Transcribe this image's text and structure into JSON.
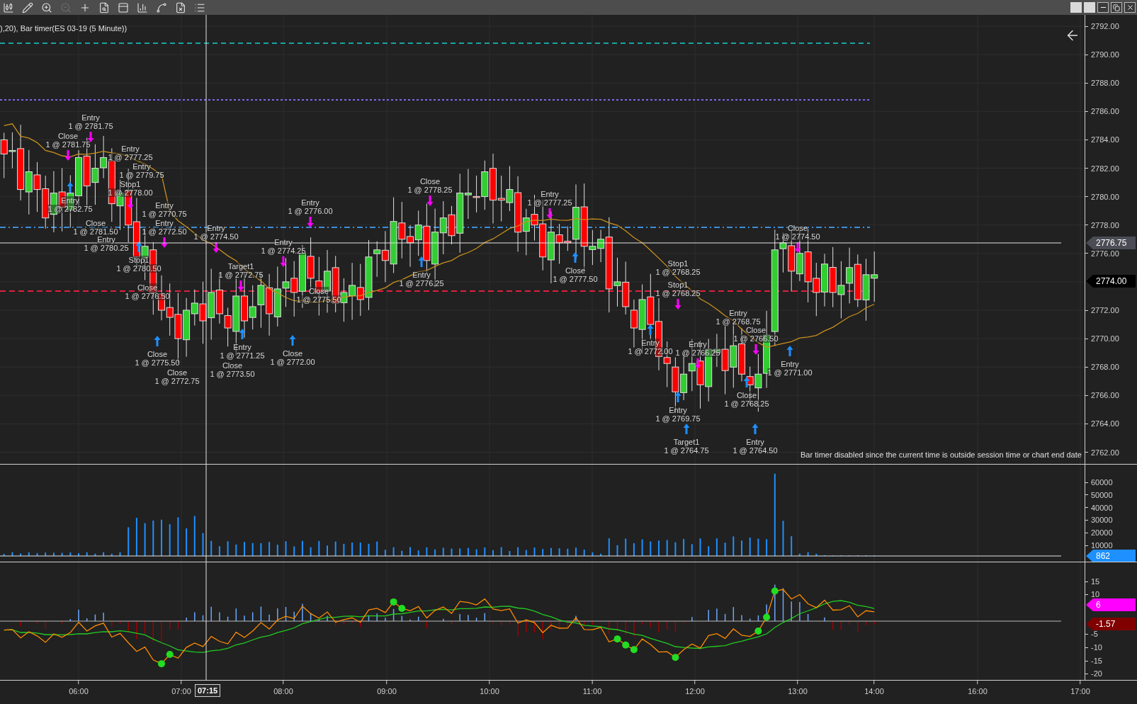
{
  "toolbar": [
    {
      "disabled": false
    },
    {
      "disabled": false
    },
    {
      "disabled": false
    },
    {
      "disabled": true
    },
    {
      "disabled": false
    },
    {
      "disabled": false
    },
    {
      "disabled": false
    },
    {
      "disabled": false
    },
    {
      "disabled": false
    },
    {
      "disabled": false
    },
    {
      "disabled": false
    }
  ],
  "chart_title": "),20), Bar timer(ES 03-19 (5 Minute))",
  "price_axis": {
    "ticks": [
      "2792.00",
      "2790.00",
      "2788.00",
      "2786.00",
      "2784.00",
      "2782.00",
      "2780.00",
      "2778.00",
      "2776.00",
      "2772.00",
      "2770.00",
      "2768.00",
      "2766.00",
      "2764.00",
      "2762.00"
    ],
    "markers": [
      {
        "kind": "crosshair",
        "text": "2776.75"
      },
      {
        "kind": "last",
        "text": "2774.00"
      }
    ]
  },
  "trade_labels": [
    {
      "name": "Entry",
      "price": "1 @ 2781.75"
    },
    {
      "name": "Close",
      "price": "1 @ 2781.75"
    },
    {
      "name": "Entry",
      "price": "1 @ 2777.25"
    },
    {
      "name": "Entry",
      "price": "1 @ 2779.75"
    },
    {
      "name": "Entry",
      "price": "1 @ 2782.75"
    },
    {
      "name": "Stop1",
      "price": "1 @ 2778.00"
    },
    {
      "name": "Entry",
      "price": "1 @ 2770.75"
    },
    {
      "name": "Entry",
      "price": "1 @ 2776.00"
    },
    {
      "name": "Close",
      "price": "1 @ 2778.25"
    },
    {
      "name": "Entry",
      "price": "1 @ 2777.25"
    },
    {
      "name": "Close",
      "price": "1 @ 2781.50"
    },
    {
      "name": "Entry",
      "price": "1 @ 2780.25"
    },
    {
      "name": "Entry",
      "price": "1 @ 2772.50"
    },
    {
      "name": "Entry",
      "price": "1 @ 2774.50"
    },
    {
      "name": "Entry",
      "price": "1 @ 2774.25"
    },
    {
      "name": "Close",
      "price": "1 @ 2774.50"
    },
    {
      "name": "Stop1",
      "price": "1 @ 2780.50"
    },
    {
      "name": "Target1",
      "price": "1 @ 2772.75"
    },
    {
      "name": "Close",
      "price": "1 @ 2776.50"
    },
    {
      "name": "Close",
      "price": "1 @ 2775.50"
    },
    {
      "name": "Entry",
      "price": "1 @ 2776.25"
    },
    {
      "name": "Close",
      "price": "1 @ 2777.50"
    },
    {
      "name": "Stop1",
      "price": "1 @ 2768.25"
    },
    {
      "name": "Stop1",
      "price": "1 @ 2768.25"
    },
    {
      "name": "Entry",
      "price": "1 @ 2768.75"
    },
    {
      "name": "Close",
      "price": "1 @ 2775.50"
    },
    {
      "name": "Close",
      "price": "1 @ 2772.75"
    },
    {
      "name": "Entry",
      "price": "1 @ 2771.25"
    },
    {
      "name": "Close",
      "price": "1 @ 2773.50"
    },
    {
      "name": "Close",
      "price": "1 @ 2772.00"
    },
    {
      "name": "Entry",
      "price": "1 @ 2772.00"
    },
    {
      "name": "Entry",
      "price": "1 @ 2766.25"
    },
    {
      "name": "Close",
      "price": "1 @ 2766.50"
    },
    {
      "name": "Entry",
      "price": "1 @ 2771.00"
    },
    {
      "name": "Close",
      "price": "1 @ 2768.25"
    },
    {
      "name": "Entry",
      "price": "1 @ 2769.75"
    },
    {
      "name": "Target1",
      "price": "1 @ 2764.75"
    },
    {
      "name": "Entry",
      "price": "1 @ 2764.50"
    }
  ],
  "bar_timer_message": "Bar timer disabled since the current time is outside session time or chart end date",
  "volume_axis": {
    "ticks": [
      "60000",
      "50000",
      "40000",
      "30000",
      "20000",
      "10000"
    ],
    "marker": "862"
  },
  "oscillator_axis": {
    "ticks": [
      "15",
      "10",
      "-5",
      "-10",
      "-15",
      "-20"
    ],
    "markers": [
      {
        "text": "6",
        "color": "#ff00ff"
      },
      {
        "text": "-1.57",
        "color": "#800000"
      }
    ]
  },
  "time_axis": {
    "labels": [
      "06:00",
      "07:00",
      "08:00",
      "09:00",
      "10:00",
      "11:00",
      "12:00",
      "13:00",
      "14:00",
      "16:00",
      "17:00"
    ],
    "crosshair_time": "07:15"
  }
}
